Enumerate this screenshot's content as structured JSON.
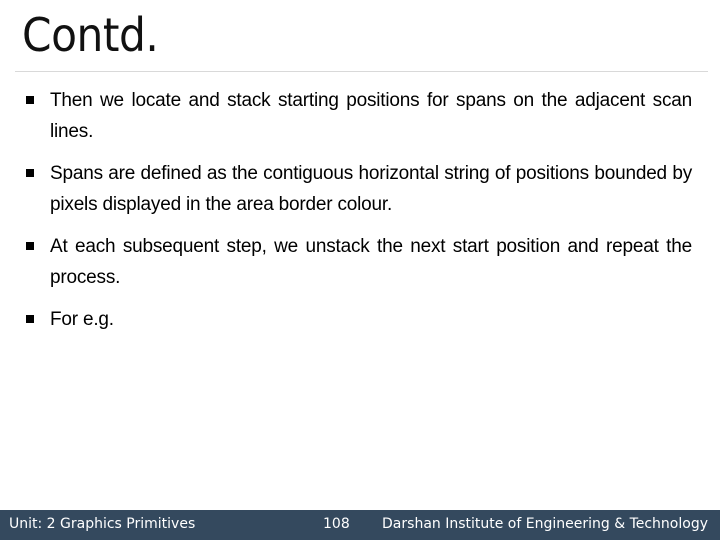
{
  "slide": {
    "title": "Contd.",
    "bullets": [
      "Then we locate and stack starting positions for spans on the adjacent scan lines.",
      "Spans are defined as the contiguous horizontal string of positions bounded by pixels displayed in the area border colour.",
      "At each subsequent step, we unstack the next start position and repeat the process.",
      "For e.g."
    ]
  },
  "footer": {
    "unit": "Unit: 2 Graphics Primitives",
    "page_number": "108",
    "institute": "Darshan Institute of Engineering & Technology",
    "background_color": "#34495e"
  }
}
